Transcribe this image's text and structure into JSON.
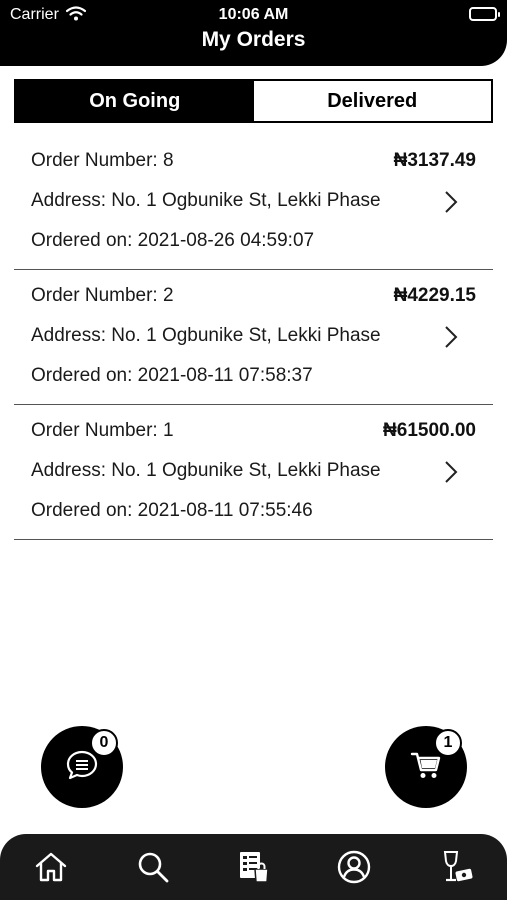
{
  "status_bar": {
    "carrier": "Carrier",
    "time": "10:06 AM"
  },
  "header": {
    "title": "My Orders"
  },
  "tabs": [
    {
      "label": "On Going",
      "active": true
    },
    {
      "label": "Delivered",
      "active": false
    }
  ],
  "orders": [
    {
      "number": "Order Number: 8",
      "price": "₦3137.49",
      "address": "Address: No. 1 Ogbunike St, Lekki Phase",
      "ordered_on": "Ordered on: 2021-08-26 04:59:07"
    },
    {
      "number": "Order Number: 2",
      "price": "₦4229.15",
      "address": "Address: No. 1 Ogbunike St, Lekki Phase",
      "ordered_on": "Ordered on: 2021-08-11 07:58:37"
    },
    {
      "number": "Order Number: 1",
      "price": "₦61500.00",
      "address": "Address: No. 1 Ogbunike St, Lekki Phase",
      "ordered_on": "Ordered on: 2021-08-11 07:55:46"
    }
  ],
  "fabs": {
    "chat_count": "0",
    "cart_count": "1"
  },
  "bottom_nav": [
    "home-icon",
    "search-icon",
    "orders-icon",
    "profile-icon",
    "wine-voucher-icon"
  ],
  "colors": {
    "primary": "#000000",
    "nav_background": "#1a1a1a",
    "background": "#ffffff"
  }
}
